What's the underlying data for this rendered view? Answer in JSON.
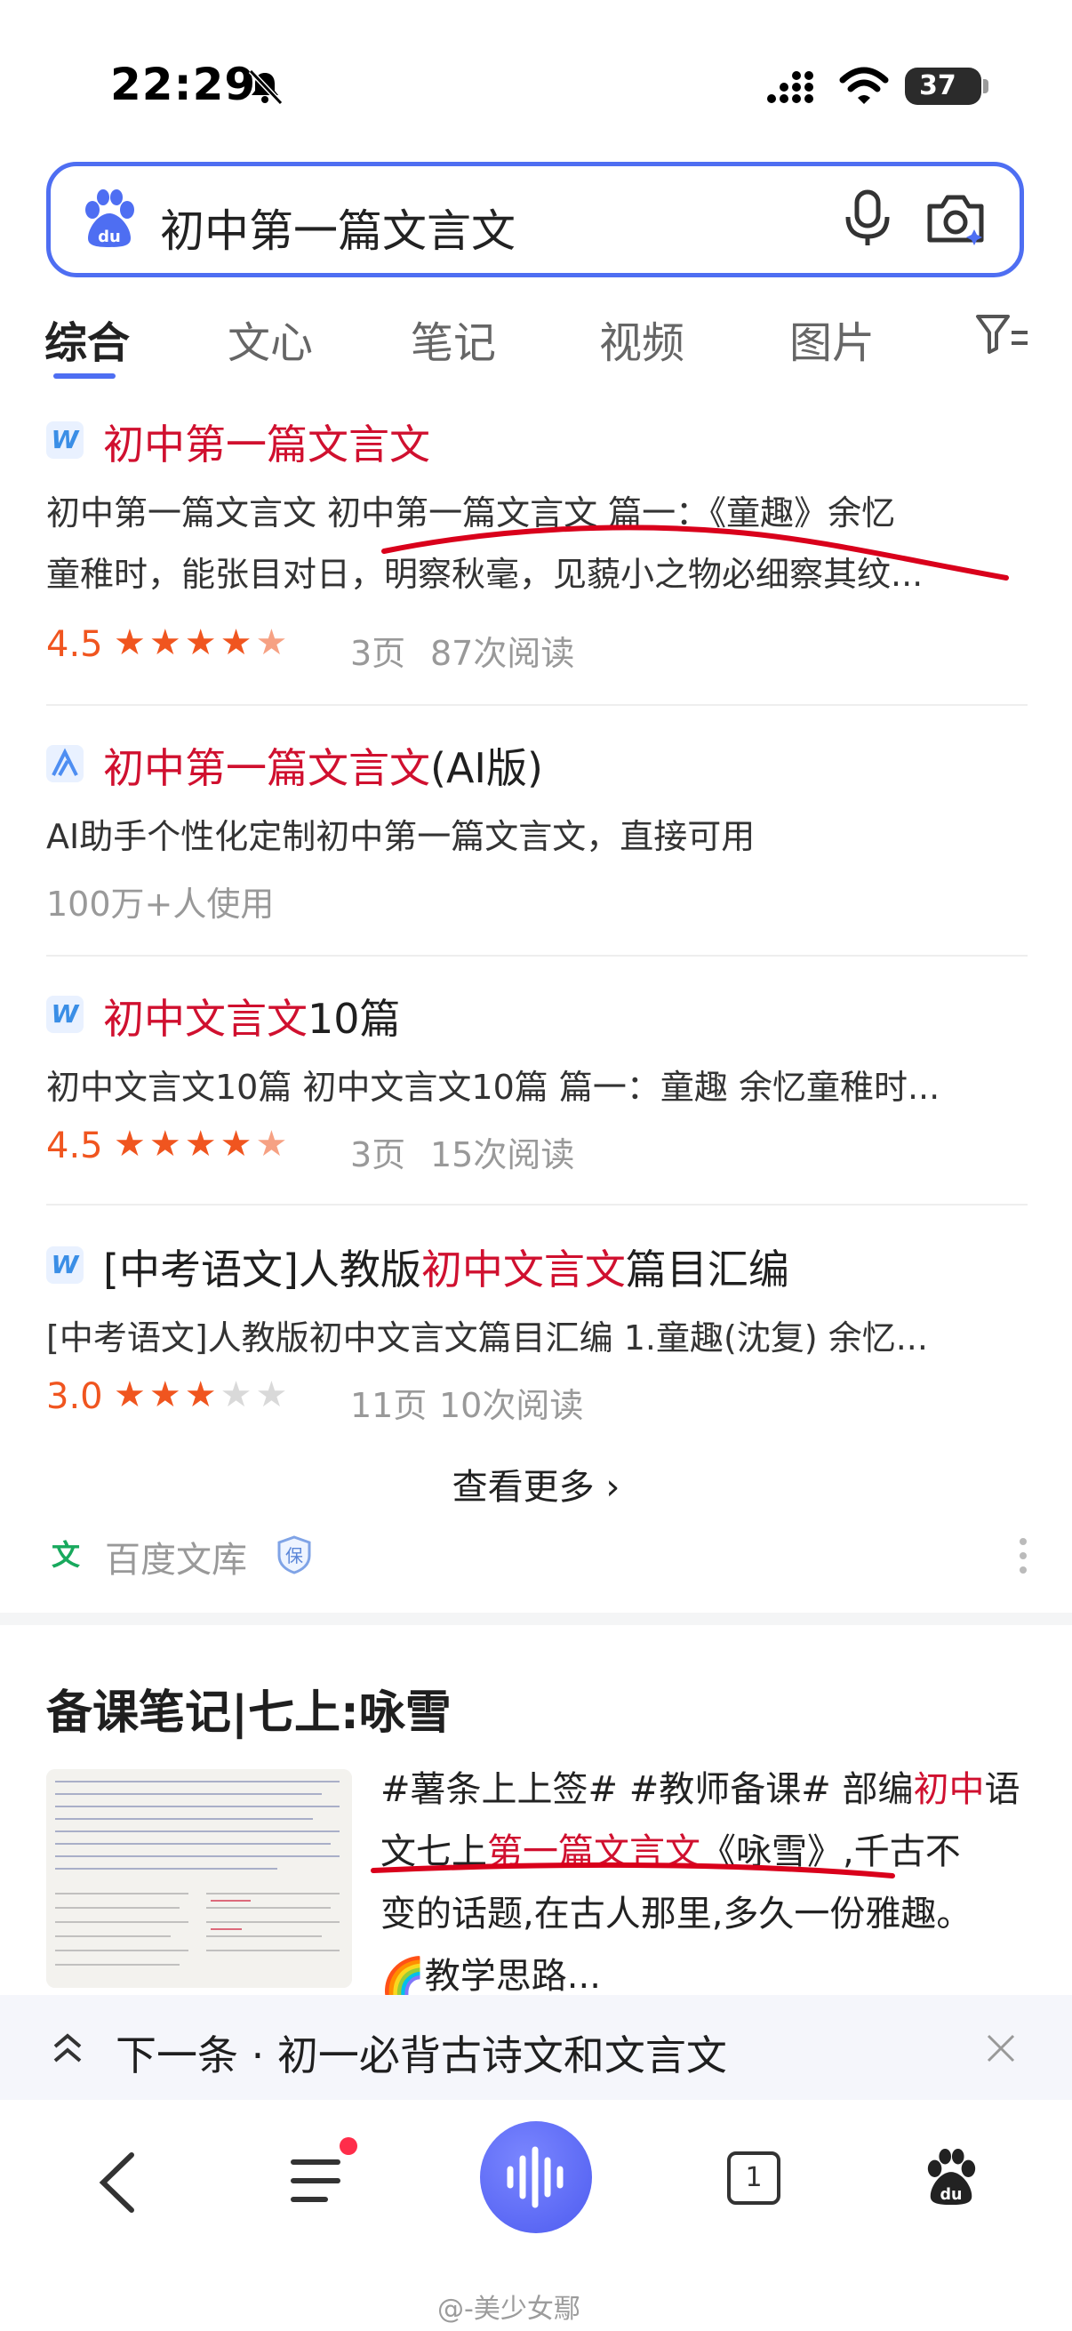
{
  "status_bar": {
    "time": "22:29",
    "battery": "37"
  },
  "search": {
    "query": "初中第一篇文言文"
  },
  "tabs": [
    {
      "label": "综合",
      "active": true
    },
    {
      "label": "文心"
    },
    {
      "label": "笔记"
    },
    {
      "label": "视频"
    },
    {
      "label": "图片"
    }
  ],
  "results": [
    {
      "icon": "W",
      "title": "初中第一篇文言文",
      "desc_1": "初中第一篇文言文 初中第一篇文言文 篇一：《童趣》余忆",
      "desc_2": "童稚时，能张目对日，明察秋毫，见藐小之物必细察其纹...",
      "rating": "4.5",
      "stars": 4.5,
      "pages": "3页",
      "reads": "87次阅读"
    },
    {
      "icon": "AI",
      "title_hl": "初中第一篇文言文",
      "title_rest": "(AI版)",
      "desc": "AI助手个性化定制初中第一篇文言文，直接可用",
      "users": "100万+人使用"
    },
    {
      "icon": "W",
      "title_hl": "初中文言文",
      "title_rest": "10篇",
      "desc": "初中文言文10篇 初中文言文10篇 篇一：童趣 余忆童稚时...",
      "rating": "4.5",
      "stars": 4.5,
      "pages": "3页",
      "reads": "15次阅读"
    },
    {
      "icon": "W",
      "title_pre": "[中考语文]人教版",
      "title_hl": "初中文言文",
      "title_rest": "篇目汇编",
      "desc": "[中考语文]人教版初中文言文篇目汇编 1.童趣(沈复) 余忆...",
      "rating": "3.0",
      "stars": 3,
      "pages": "11页",
      "reads": "10次阅读"
    }
  ],
  "see_more": "查看更多",
  "source": {
    "name": "百度文库",
    "badge": "保",
    "logo": "文"
  },
  "note": {
    "title": "备课笔记|七上:咏雪",
    "line_1a": "#薯条上上签# #教师备课# 部编",
    "line_1b": "初中",
    "line_1c": "语",
    "line_2a": "文七上",
    "line_2b": "第一篇文言文",
    "line_2c": "《咏雪》",
    "line_2d": ",千古不",
    "line_3": "变的话题,在古人那里,多久一份雅趣。",
    "line_4": "🌈教学思路..."
  },
  "next_bar": {
    "text": "下一条 · 初一必背古诗文和文言文"
  },
  "nav": {
    "tabs_count": "1"
  },
  "watermark": "@-美少女鄢",
  "colors": {
    "accent": "#4e6ef2",
    "highlight": "#d0102f",
    "rating": "#f0551f"
  }
}
